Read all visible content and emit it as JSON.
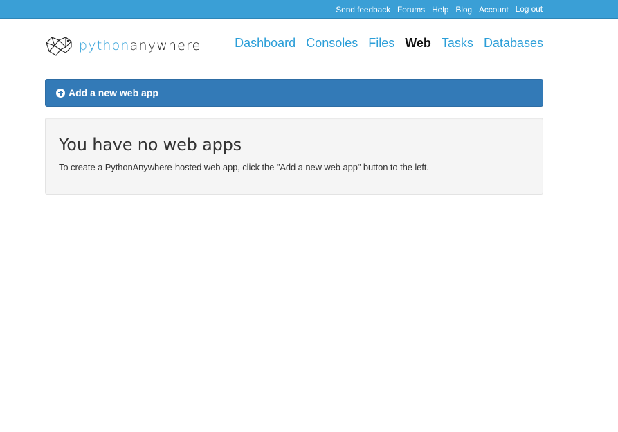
{
  "topbar": {
    "links": [
      "Send feedback",
      "Forums",
      "Help",
      "Blog",
      "Account",
      "Log out"
    ]
  },
  "logo": {
    "python": "python",
    "anywhere": "anywhere"
  },
  "nav": {
    "items": [
      "Dashboard",
      "Consoles",
      "Files",
      "Web",
      "Tasks",
      "Databases"
    ],
    "active": "Web"
  },
  "add_button": {
    "label": "Add a new web app",
    "icon": "plus-circle-icon"
  },
  "empty_state": {
    "title": "You have no web apps",
    "message": "To create a PythonAnywhere-hosted web app, click the \"Add a new web app\" button to the left."
  },
  "colors": {
    "topbar": "#3a9fd6",
    "accent": "#2b9ed8",
    "primary_button": "#337ab7",
    "well": "#f5f5f5"
  }
}
